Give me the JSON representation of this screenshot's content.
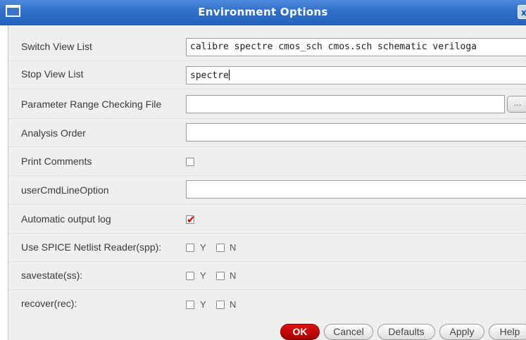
{
  "window": {
    "title": "Environment Options",
    "close_label": "x"
  },
  "rows": {
    "switch_view_list": {
      "label": "Switch View List",
      "value": "calibre spectre cmos_sch cmos.sch schematic veriloga"
    },
    "stop_view_list": {
      "label": "Stop View List",
      "value": "spectre"
    },
    "param_range_file": {
      "label": "Parameter Range Checking File",
      "value": "",
      "browse_label": "..."
    },
    "analysis_order": {
      "label": "Analysis Order",
      "value": ""
    },
    "print_comments": {
      "label": "Print Comments",
      "checked": false
    },
    "user_cmd_line_option": {
      "label": "userCmdLineOption",
      "value": ""
    },
    "automatic_output_log": {
      "label": "Automatic output log",
      "checked": true
    },
    "use_spice_netlist_reader": {
      "label": "Use SPICE Netlist Reader(spp):",
      "y_label": "Y",
      "n_label": "N"
    },
    "savestate": {
      "label": "savestate(ss):",
      "y_label": "Y",
      "n_label": "N"
    },
    "recover": {
      "label": "recover(rec):",
      "y_label": "Y",
      "n_label": "N"
    }
  },
  "buttons": {
    "ok": "OK",
    "cancel": "Cancel",
    "defaults": "Defaults",
    "apply": "Apply",
    "help": "Help"
  },
  "colors": {
    "titlebar": "#2f6fc9",
    "ok_button": "#c40000",
    "check_mark": "#c40000"
  }
}
